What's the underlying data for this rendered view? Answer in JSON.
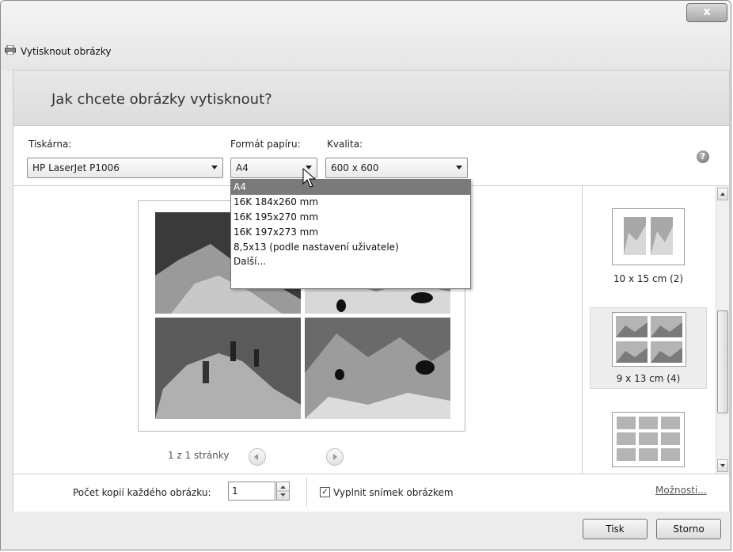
{
  "window": {
    "title": "Vytisknout obrázky",
    "close_label": "x"
  },
  "header": {
    "title": "Jak chcete obrázky vytisknout?"
  },
  "printer": {
    "label": "Tiskárna:",
    "value": "HP LaserJet P1006"
  },
  "paper": {
    "label": "Formát papíru:",
    "value": "A4",
    "options": [
      "A4",
      "16K 184x260 mm",
      "16K 195x270 mm",
      "16K 197x273 mm",
      "8,5x13 (podle nastavení uživatele)",
      "Další..."
    ]
  },
  "quality": {
    "label": "Kvalita:",
    "value": "600 x 600"
  },
  "help_icon": "?",
  "preview": {
    "page_text": "1 z 1 stránky"
  },
  "layouts": [
    {
      "label": "10 x 15 cm (2)"
    },
    {
      "label": "9 x 13 cm (4)"
    },
    {
      "label": ""
    }
  ],
  "copies": {
    "label": "Počet kopií každého obrázku:",
    "value": "1"
  },
  "fill": {
    "label": "Vyplnit snímek obrázkem",
    "checked": true
  },
  "options_link": "Možnosti...",
  "buttons": {
    "print": "Tisk",
    "cancel": "Storno"
  }
}
